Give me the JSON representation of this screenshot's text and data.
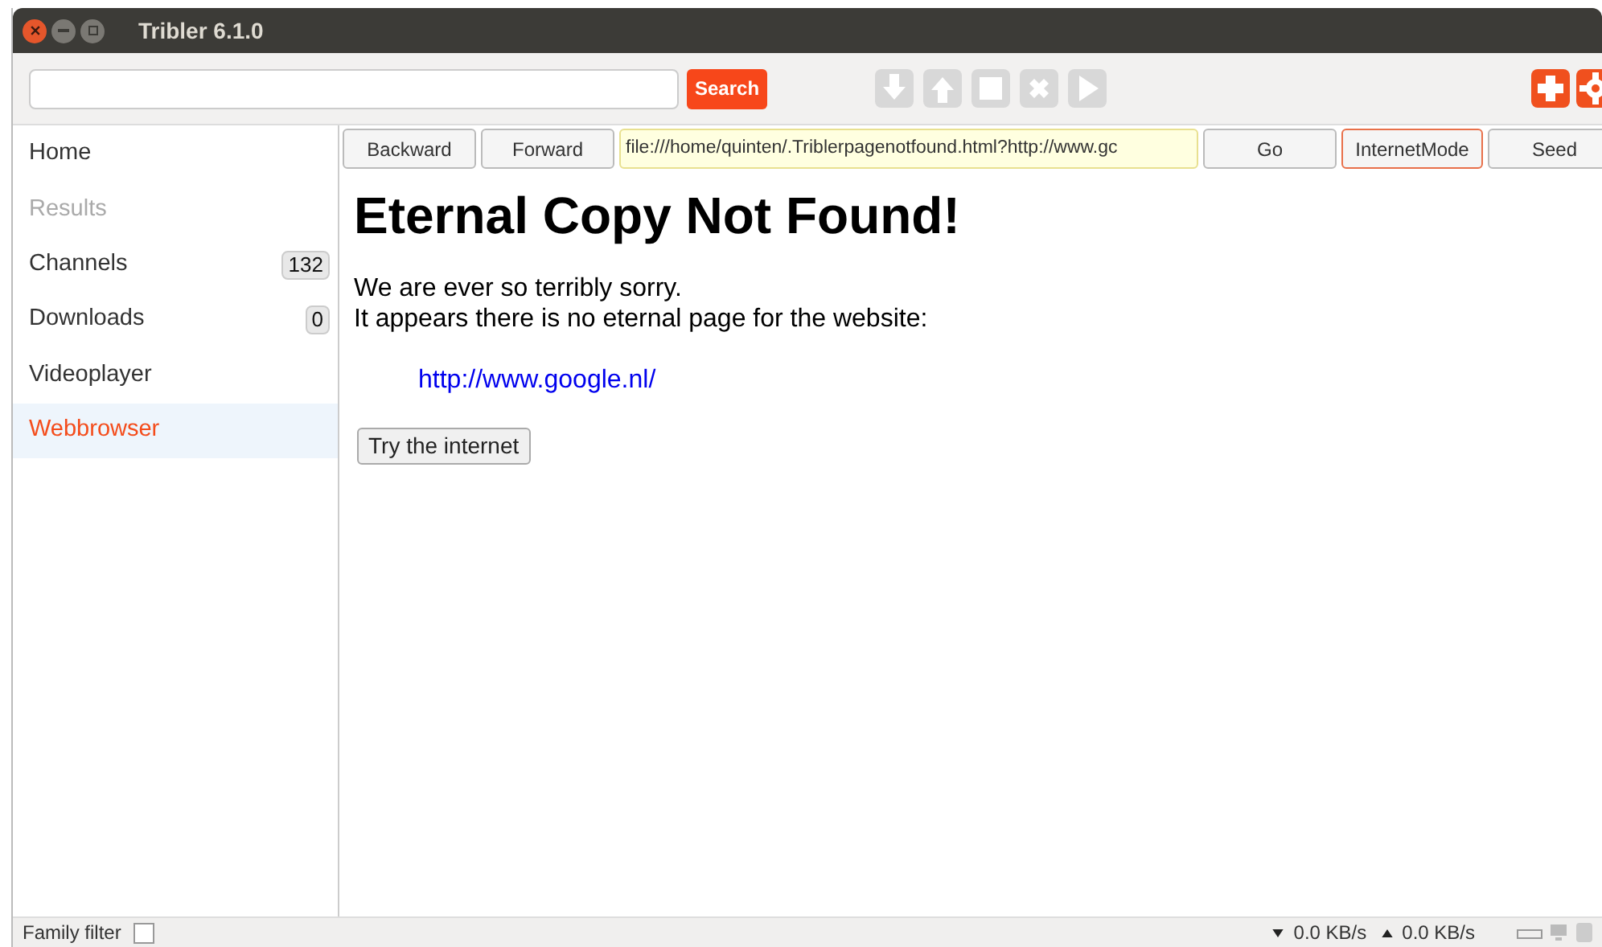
{
  "window": {
    "title": "Tribler 6.1.0"
  },
  "toolbar": {
    "search_button": "Search",
    "actions": [
      {
        "kind": "download",
        "disabled": true
      },
      {
        "kind": "upload",
        "disabled": true
      },
      {
        "kind": "stop",
        "disabled": true
      },
      {
        "kind": "delete",
        "disabled": true
      },
      {
        "kind": "play",
        "disabled": true
      },
      {
        "kind": "add",
        "disabled": false
      },
      {
        "kind": "settings",
        "disabled": false
      }
    ]
  },
  "sidebar": {
    "items": [
      {
        "label": "Home",
        "disabled": false,
        "selected": false
      },
      {
        "label": "Results",
        "disabled": true,
        "selected": false
      },
      {
        "label": "Channels",
        "count": "132",
        "disabled": false,
        "selected": false
      },
      {
        "label": "Downloads",
        "count": "0",
        "disabled": false,
        "selected": false
      },
      {
        "label": "Videoplayer",
        "disabled": false,
        "selected": false
      },
      {
        "label": "Webbrowser",
        "disabled": false,
        "selected": true
      }
    ]
  },
  "browser": {
    "backward": "Backward",
    "forward": "Forward",
    "url": "file:///home/quinten/.Triblerpagenotfound.html?http://www.gc",
    "go": "Go",
    "mode": {
      "label": "InternetMode",
      "highlighted": true
    },
    "seed": "Seed"
  },
  "page": {
    "heading": "Eternal Copy Not Found!",
    "lines": [
      "We are ever so terribly sorry.",
      "It appears there is no eternal page for the website:"
    ],
    "link": "http://www.google.nl/",
    "button": "Try the internet"
  },
  "status_bar": {
    "family_filter": {
      "label": "Family filter",
      "checked": false
    },
    "download_speed": "0.0 KB/s",
    "upload_speed": "0.0 KB/s"
  }
}
